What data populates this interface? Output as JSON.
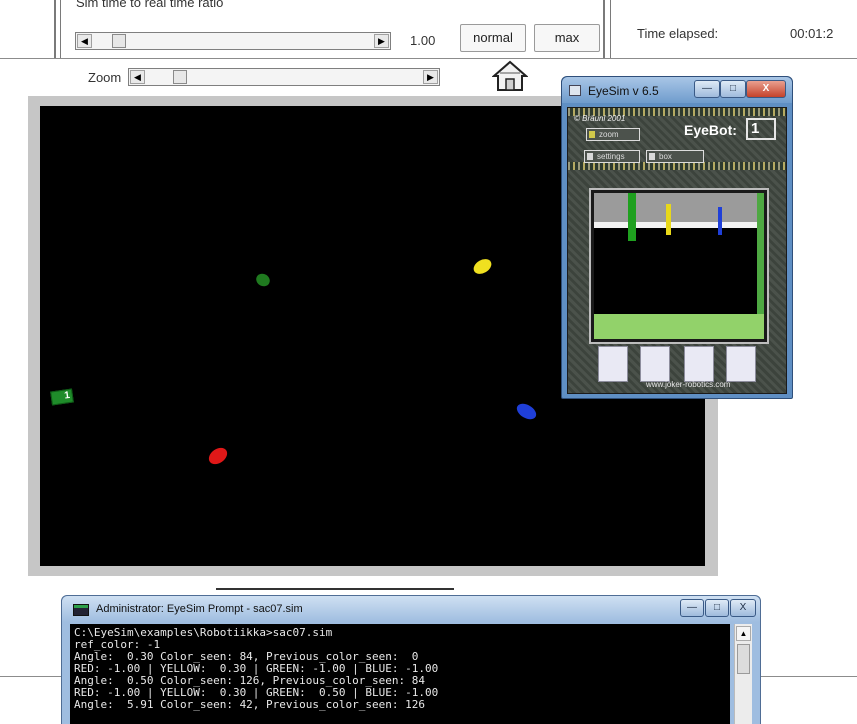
{
  "main_window": {
    "sim_ratio_label": "Sim time to real time ratio",
    "sim_ratio_value": "1.00",
    "sim_ratio_slider_level": 0.1,
    "normal_label": "normal",
    "max_label": "max",
    "time_elapsed_label": "Time elapsed:",
    "time_elapsed_value": "00:01:2",
    "zoom_label": "Zoom",
    "zoom_slider_level": 0.12,
    "home_icon": "home-icon",
    "scroll_left_glyph": "◀",
    "scroll_right_glyph": "▶"
  },
  "simulation": {
    "background": "#000000",
    "balls": [
      {
        "name": "green-ball",
        "color": "#1f7a1f"
      },
      {
        "name": "yellow-ball",
        "color": "#f0e020"
      },
      {
        "name": "blue-ball",
        "color": "#1f3fd8"
      },
      {
        "name": "red-ball",
        "color": "#e01818"
      }
    ],
    "robot_id": "1"
  },
  "eyesim_window": {
    "title": "EyeSim v 6.5",
    "minimize_glyph": "—",
    "maximize_glyph": "□",
    "close_glyph": "X",
    "copyright": "© Bräunl 2001",
    "zoom_label": "zoom",
    "settings_label": "settings",
    "box_label": "box",
    "eyebot_label": "EyeBot:",
    "eyebot_number": "1",
    "website": "www.joker-robotics.com",
    "camera_colors": {
      "green": "#1fa01f",
      "yellow": "#e8d81a",
      "blue": "#1f3fd8"
    }
  },
  "terminal": {
    "title": "Administrator: EyeSim Prompt - sac07.sim",
    "minimize_glyph": "—",
    "maximize_glyph": "□",
    "close_glyph": "X",
    "scroll_up_glyph": "▲",
    "lines": [
      "C:\\EyeSim\\examples\\Robotiikka>sac07.sim",
      "ref_color: -1",
      "Angle:  0.30 Color_seen: 84, Previous_color_seen:  0",
      "RED: -1.00 | YELLOW:  0.30 | GREEN: -1.00 | BLUE: -1.00",
      "Angle:  0.50 Color_seen: 126, Previous_color_seen: 84",
      "RED: -1.00 | YELLOW:  0.30 | GREEN:  0.50 | BLUE: -1.00",
      "Angle:  5.91 Color_seen: 42, Previous_color_seen: 126"
    ]
  }
}
